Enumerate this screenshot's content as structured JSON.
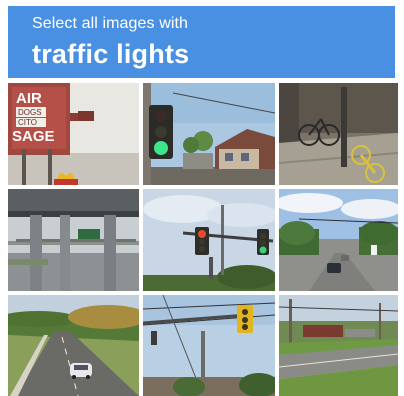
{
  "header": {
    "instruction": "Select all images with",
    "target": "traffic lights",
    "background": "#4a90e2",
    "text_color": "#ffffff"
  },
  "tiles": [
    {
      "id": 1,
      "signage_text": [
        "AIR",
        "DOGS",
        "CITO",
        "SAGE"
      ]
    },
    {
      "id": 2
    },
    {
      "id": 3
    },
    {
      "id": 4
    },
    {
      "id": 5
    },
    {
      "id": 6
    },
    {
      "id": 7
    },
    {
      "id": 8
    },
    {
      "id": 9
    }
  ]
}
